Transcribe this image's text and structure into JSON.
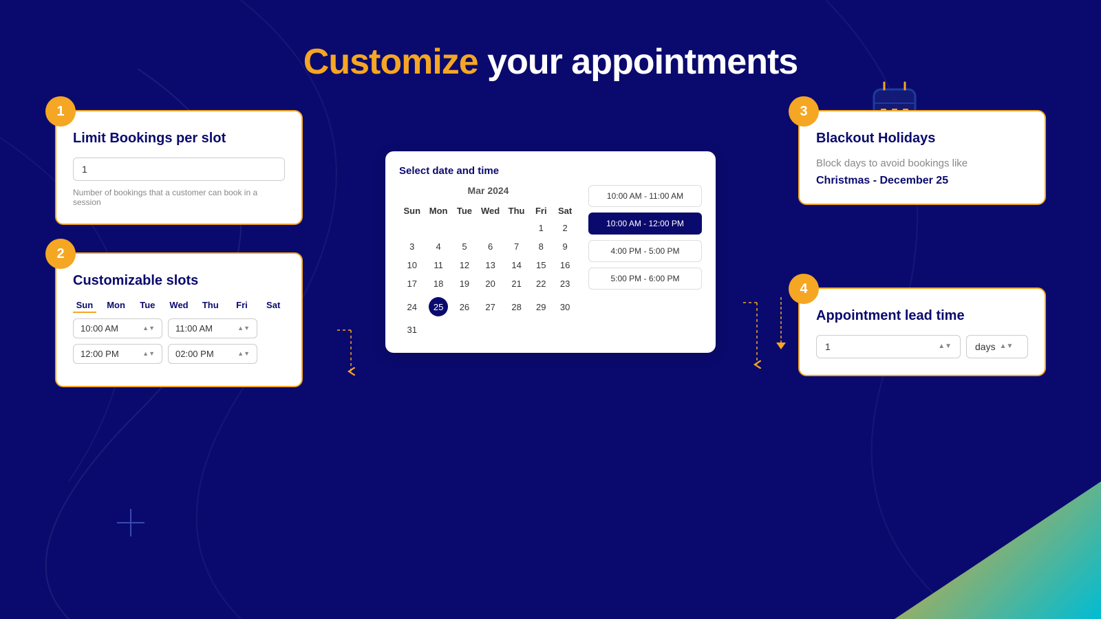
{
  "title": {
    "highlight": "Customize",
    "normal": " your appointments"
  },
  "card1": {
    "badge": "1",
    "title": "Limit Bookings per slot",
    "input_value": "1",
    "hint": "Number of bookings that a customer can book in a session"
  },
  "card2": {
    "badge": "2",
    "title": "Customizable slots",
    "days": [
      "Sun",
      "Mon",
      "Tue",
      "Wed",
      "Thu",
      "Fri",
      "Sat"
    ],
    "slots": [
      [
        "10:00 AM",
        "11:00 AM"
      ],
      [
        "12:00 PM",
        "02:00 PM"
      ]
    ]
  },
  "calendar": {
    "title": "Select date and time",
    "month": "Mar  2024",
    "days": [
      "Sun",
      "Mon",
      "Tue",
      "Wed",
      "Thu",
      "Fri",
      "Sat"
    ],
    "weeks": [
      [
        "",
        "",
        "",
        "",
        "",
        "1",
        "2"
      ],
      [
        "3",
        "4",
        "5",
        "6",
        "7",
        "8",
        "9"
      ],
      [
        "10",
        "11",
        "12",
        "13",
        "14",
        "15",
        "16"
      ],
      [
        "17",
        "18",
        "19",
        "20",
        "21",
        "22",
        "23"
      ],
      [
        "24",
        "25",
        "26",
        "27",
        "28",
        "29",
        "30"
      ],
      [
        "31",
        "",
        "",
        "",
        "",
        "",
        ""
      ]
    ],
    "today": "25",
    "time_slots": [
      {
        "label": "10:00 AM - 11:00 AM",
        "active": false
      },
      {
        "label": "10:00 AM - 12:00 PM",
        "active": true
      },
      {
        "label": "4:00 PM - 5:00 PM",
        "active": false
      },
      {
        "label": "5:00 PM - 6:00 PM",
        "active": false
      }
    ]
  },
  "card3": {
    "badge": "3",
    "title": "Blackout Holidays",
    "description": "Block days to avoid bookings like",
    "holiday": "Christmas - December 25"
  },
  "card4": {
    "badge": "4",
    "title": "Appointment lead time",
    "value": "1",
    "unit": "days"
  }
}
